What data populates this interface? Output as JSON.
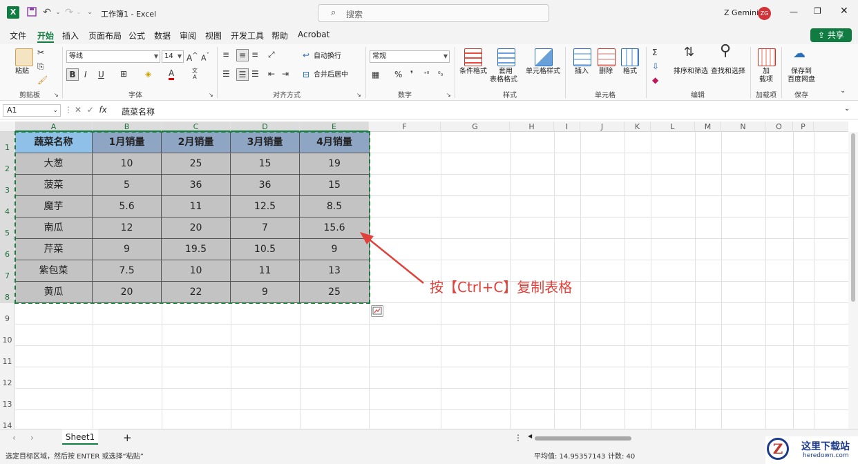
{
  "window": {
    "title": "工作簿1 - Excel",
    "user": "Z Gemini",
    "user_initials": "ZG",
    "search_placeholder": "搜索"
  },
  "menu": [
    "文件",
    "开始",
    "插入",
    "页面布局",
    "公式",
    "数据",
    "审阅",
    "视图",
    "开发工具",
    "帮助",
    "Acrobat"
  ],
  "share_label": "共享",
  "ribbon": {
    "paste": "粘贴",
    "clipboard": "剪贴板",
    "font_name": "等线",
    "font_size": "14",
    "font_group": "字体",
    "bold": "B",
    "italic": "I",
    "underline": "U",
    "wrap": "自动换行",
    "merge": "合并后居中",
    "align_group": "对齐方式",
    "number_format": "常规",
    "number_group": "数字",
    "percent": "%",
    "comma": "❜",
    "cond_format": "条件格式",
    "table_format_1": "套用",
    "table_format_2": "表格格式",
    "cell_style": "单元格样式",
    "style_group": "样式",
    "insert": "插入",
    "delete": "删除",
    "format": "格式",
    "cells_group": "单元格",
    "sort_filter": "排序和筛选",
    "find_select": "查找和选择",
    "edit_group": "编辑",
    "addins_1": "加",
    "addins_2": "载项",
    "addins_group": "加载项",
    "save_1": "保存到",
    "save_2": "百度网盘",
    "save_group": "保存"
  },
  "formula_bar": {
    "name_box": "A1",
    "content": "蔬菜名称"
  },
  "columns": [
    "A",
    "B",
    "C",
    "D",
    "E",
    "F",
    "G",
    "H",
    "I",
    "J",
    "K",
    "L",
    "M",
    "N",
    "O",
    "P"
  ],
  "rows": [
    "1",
    "2",
    "3",
    "4",
    "5",
    "6",
    "7",
    "8",
    "9",
    "10",
    "11",
    "12",
    "13",
    "14"
  ],
  "table": {
    "headers": [
      "蔬菜名称",
      "1月销量",
      "2月销量",
      "3月销量",
      "4月销量"
    ],
    "rows": [
      [
        "大葱",
        "10",
        "25",
        "15",
        "19"
      ],
      [
        "菠菜",
        "5",
        "36",
        "36",
        "15"
      ],
      [
        "魔芋",
        "5.6",
        "11",
        "12.5",
        "8.5"
      ],
      [
        "南瓜",
        "12",
        "20",
        "7",
        "15.6"
      ],
      [
        "芹菜",
        "9",
        "19.5",
        "10.5",
        "9"
      ],
      [
        "紫包菜",
        "7.5",
        "10",
        "11",
        "13"
      ],
      [
        "黄瓜",
        "20",
        "22",
        "9",
        "25"
      ]
    ]
  },
  "annotation": "按【Ctrl+C】复制表格",
  "sheet_tab": "Sheet1",
  "status": {
    "message": "选定目标区域，然后按 ENTER 或选择“粘贴”",
    "average": "平均值: 14.95357143",
    "count": "计数: 40"
  },
  "watermark": {
    "text": "这里下载站",
    "url": "heredown.com"
  }
}
